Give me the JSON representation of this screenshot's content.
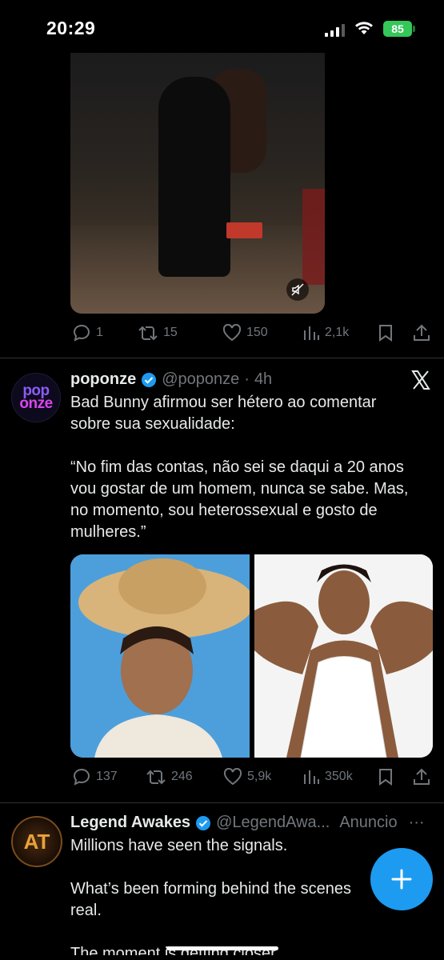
{
  "status_bar": {
    "time": "20:29",
    "battery": "85"
  },
  "first_tweet_actions": {
    "replies": "1",
    "reposts": "15",
    "likes": "150",
    "views": "2,1k"
  },
  "tweet_poponze": {
    "avatar_text_top": "pop",
    "avatar_text_bottom": "onze",
    "name": "poponze",
    "handle": "@poponze",
    "separator": "·",
    "time": "4h",
    "text": "Bad Bunny afirmou ser hétero ao comentar\nsobre sua sexualidade:\n\n“No fim das contas, não sei se daqui a 20 anos\nvou gostar de um homem, nunca se sabe. Mas,\nno momento, sou heterossexual e gosto de\nmulheres.”",
    "actions": {
      "replies": "137",
      "reposts": "246",
      "likes": "5,9k",
      "views": "350k"
    }
  },
  "tweet_legend": {
    "avatar_text": "AT",
    "name": "Legend Awakes",
    "handle": "@LegendAwa...",
    "ad_label": "Anuncio",
    "more": "···",
    "text": "Millions have seen the signals.\n\nWhat’s been forming behind the scenes\nreal.\n\nThe moment is getting closer."
  },
  "colors": {
    "accent": "#1d9bf0",
    "muted": "#71767b",
    "battery": "#34c759"
  }
}
